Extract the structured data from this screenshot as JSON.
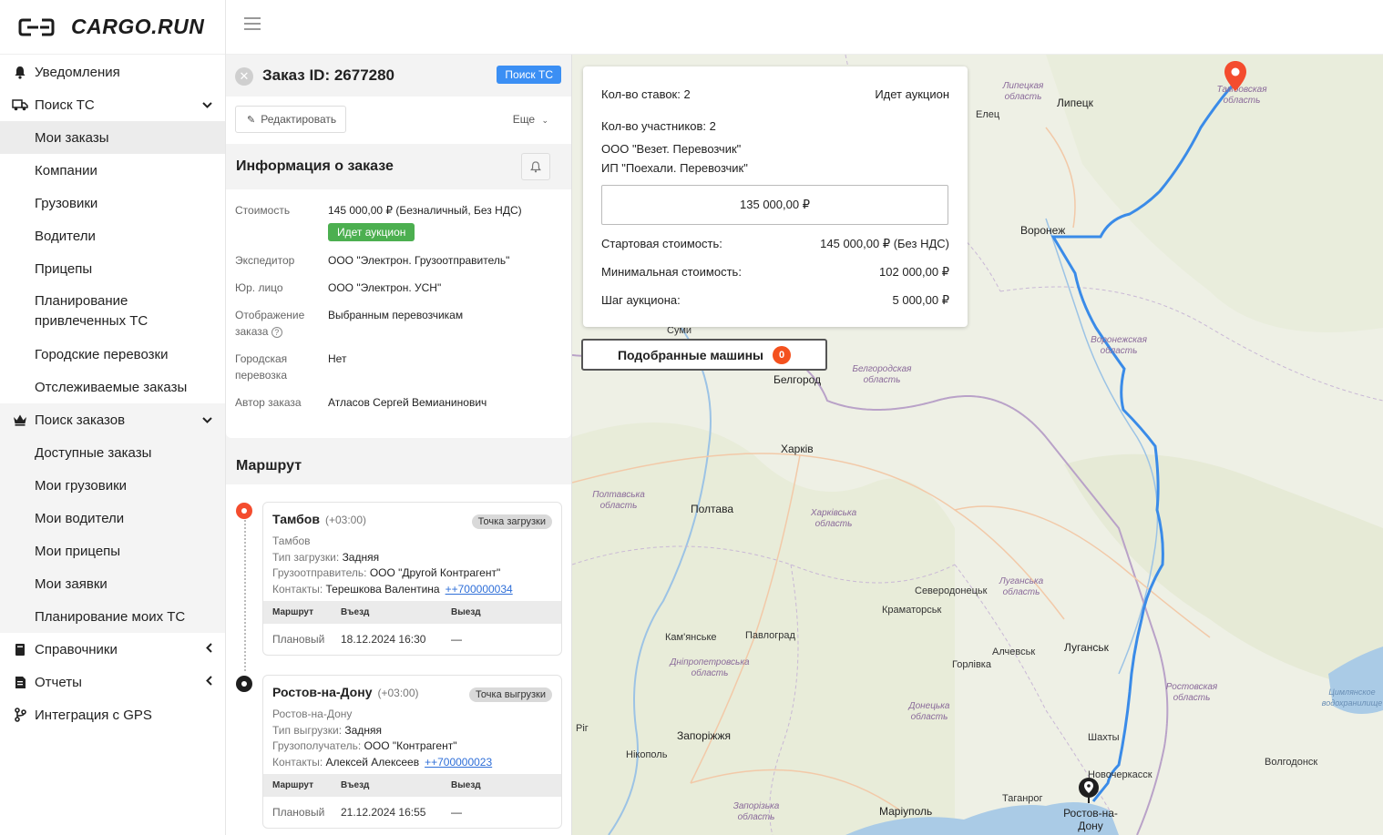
{
  "brand": {
    "name": "CARGO.RUN"
  },
  "sidebar": {
    "items": [
      {
        "label": "Уведомления",
        "icon": "bell-icon"
      },
      {
        "label": "Поиск ТС",
        "icon": "truck-icon"
      },
      {
        "label": "Мои заказы"
      },
      {
        "label": "Компании"
      },
      {
        "label": "Грузовики"
      },
      {
        "label": "Водители"
      },
      {
        "label": "Прицепы"
      },
      {
        "label": "Планирование привлеченных ТС"
      },
      {
        "label": "Городские перевозки"
      },
      {
        "label": "Отслеживаемые заказы"
      },
      {
        "label": "Поиск заказов",
        "icon": "crown-icon"
      },
      {
        "label": "Доступные заказы"
      },
      {
        "label": "Мои грузовики"
      },
      {
        "label": "Мои водители"
      },
      {
        "label": "Мои прицепы"
      },
      {
        "label": "Мои заявки"
      },
      {
        "label": "Планирование моих ТС"
      },
      {
        "label": "Справочники",
        "icon": "book-icon"
      },
      {
        "label": "Отчеты",
        "icon": "report-icon"
      },
      {
        "label": "Интеграция с GPS",
        "icon": "gps-icon"
      }
    ]
  },
  "order": {
    "title": "Заказ ID: 2677280",
    "status_tag": "Поиск ТС",
    "edit_label": "Редактировать",
    "more_label": "Еще",
    "info_title": "Информация о заказе",
    "info": {
      "cost_label": "Стоимость",
      "cost_value": "145 000,00 ₽ (Безналичный, Без НДС)",
      "auction_badge": "Идет аукцион",
      "forwarder_label": "Экспедитор",
      "forwarder_value": "ООО \"Электрон. Грузоотправитель\"",
      "legal_label": "Юр. лицо",
      "legal_value": "ООО \"Электрон. УСН\"",
      "display_label_1": "Отображение",
      "display_label_2": "заказа",
      "display_value": "Выбранным перевозчикам",
      "city_label_1": "Городская",
      "city_label_2": "перевозка",
      "city_value": "Нет",
      "author_label": "Автор заказа",
      "author_value": "Атласов Сергей Вемианинович"
    },
    "route_title": "Маршрут",
    "points": [
      {
        "city": "Тамбов",
        "tz": "(+03:00)",
        "tag": "Точка загрузки",
        "address": "Тамбов",
        "type_label": "Тип загрузки:",
        "type_value": "Задняя",
        "party_label": "Грузоотправитель:",
        "party_value": "ООО \"Другой Контрагент\"",
        "contacts_label": "Контакты:",
        "contacts_value": "Терешкова Валентина",
        "phone": "++700000034",
        "th_route": "Маршрут",
        "th_in": "Въезд",
        "th_out": "Выезд",
        "row_label": "Плановый",
        "row_in": "18.12.2024 16:30",
        "row_out": "—"
      },
      {
        "city": "Ростов-на-Дону",
        "tz": "(+03:00)",
        "tag": "Точка выгрузки",
        "address": "Ростов-на-Дону",
        "type_label": "Тип выгрузки:",
        "type_value": "Задняя",
        "party_label": "Грузополучатель:",
        "party_value": "ООО \"Контрагент\"",
        "contacts_label": "Контакты:",
        "contacts_value": "Алексей Алексеев",
        "phone": "++700000023",
        "th_route": "Маршрут",
        "th_in": "Въезд",
        "th_out": "Выезд",
        "row_label": "Плановый",
        "row_in": "21.12.2024 16:55",
        "row_out": "—"
      }
    ]
  },
  "auction": {
    "bids_count": "Кол-во ставок: 2",
    "status": "Идет аукцион",
    "participants_count": "Кол-во участников: 2",
    "participant_1": "ООО \"Везет. Перевозчик\"",
    "participant_2": "ИП \"Поехали. Перевозчик\"",
    "current_price": "135 000,00 ₽",
    "start_label": "Стартовая стоимость:",
    "start_value": "145 000,00 ₽ (Без НДС)",
    "min_label": "Минимальная стоимость:",
    "min_value": "102 000,00 ₽",
    "step_label": "Шаг аукциона:",
    "step_value": "5 000,00 ₽"
  },
  "matched": {
    "label": "Подобранные машины",
    "count": "0"
  },
  "map": {
    "cities": [
      "Липецк",
      "Елец",
      "Воронеж",
      "Белгород",
      "Харків",
      "Полтава",
      "Суми",
      "Северодонецьк",
      "Краматорськ",
      "Луганськ",
      "Алчевськ",
      "Горлівка",
      "Павлоград",
      "Кам'янське",
      "Запоріжжя",
      "Нікополь",
      "Маріуполь",
      "Таганрог",
      "Шахты",
      "Новочеркасск",
      "Ростов-на-Дону",
      "Волгодонск",
      "Рiг"
    ],
    "regions": [
      "Липецкая область",
      "Тамбовская область",
      "Воронежская область",
      "Белгородская область",
      "Полтавська область",
      "Харківська область",
      "Луганська область",
      "Дніпропетровська область",
      "Донецька область",
      "Запорізька область",
      "Ростовская область",
      "Цимлянское водохранилище"
    ],
    "route_color": "#3a8be8"
  }
}
